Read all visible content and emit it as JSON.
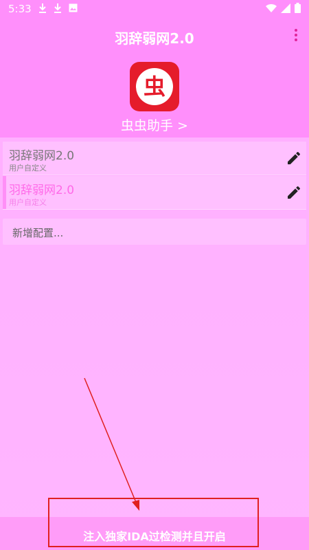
{
  "status_bar": {
    "time": "5:33",
    "icons_left": [
      "download-icon",
      "download-icon",
      "image-icon"
    ],
    "icons_right": [
      "wifi-icon",
      "signal-icon",
      "battery-icon"
    ]
  },
  "app_bar": {
    "title": "羽辞弱网2.0",
    "menu_icon": "more-vert-icon"
  },
  "header": {
    "logo_char": "虫",
    "helper_link": "虫虫助手 >"
  },
  "configs": [
    {
      "title": "羽辞弱网2.0",
      "subtitle": "用户自定义",
      "selected": false
    },
    {
      "title": "羽辞弱网2.0",
      "subtitle": "用户自定义",
      "selected": true
    }
  ],
  "add_config": {
    "label": "新增配置..."
  },
  "bottom_button": {
    "label": "注入独家IDA过检测并且开启"
  },
  "colors": {
    "header_bg": "#ff8ffb",
    "body_bg": "#ffb6ff",
    "accent": "#ff6ae8",
    "annotation_red": "#e02020"
  }
}
